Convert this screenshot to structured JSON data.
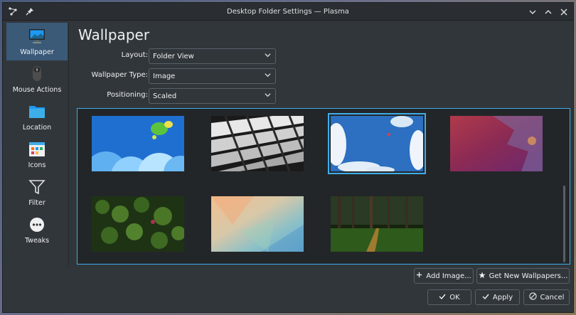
{
  "window": {
    "title": "Desktop Folder Settings — Plasma",
    "left_icons": [
      "plasma-icon",
      "pin-icon"
    ],
    "controls": [
      "chevron-down-icon",
      "chevron-up-icon",
      "close-icon"
    ]
  },
  "sidebar": {
    "items": [
      {
        "label": "Wallpaper",
        "icon": "monitor-icon",
        "active": true
      },
      {
        "label": "Mouse Actions",
        "icon": "mouse-icon",
        "active": false
      },
      {
        "label": "Location",
        "icon": "folder-icon",
        "active": false
      },
      {
        "label": "Icons",
        "icon": "icons-icon",
        "active": false
      },
      {
        "label": "Filter",
        "icon": "filter-icon",
        "active": false
      },
      {
        "label": "Tweaks",
        "icon": "tweaks-icon",
        "active": false
      }
    ]
  },
  "main": {
    "heading": "Wallpaper",
    "layout": {
      "label": "Layout:",
      "value": "Folder View"
    },
    "wallpaper_type": {
      "label": "Wallpaper Type:",
      "value": "Image"
    },
    "positioning": {
      "label": "Positioning:",
      "value": "Scaled"
    },
    "wallpapers": [
      {
        "name": "blue-cartoon-wallpaper",
        "selected": false
      },
      {
        "name": "white-architecture-wallpaper",
        "selected": false
      },
      {
        "name": "sky-clouds-wallpaper",
        "selected": true
      },
      {
        "name": "pink-red-abstract-wallpaper",
        "selected": false
      },
      {
        "name": "green-plants-wallpaper",
        "selected": false
      },
      {
        "name": "pastel-polygon-wallpaper",
        "selected": false
      },
      {
        "name": "forest-path-wallpaper",
        "selected": false
      }
    ]
  },
  "buttons": {
    "add_image": "Add Image...",
    "get_new": "Get New Wallpapers...",
    "ok": "OK",
    "apply": "Apply",
    "cancel": "Cancel"
  },
  "colors": {
    "window_bg": "#31363b",
    "accent": "#3daee9",
    "selected_sidebar": "#3a5a78"
  }
}
